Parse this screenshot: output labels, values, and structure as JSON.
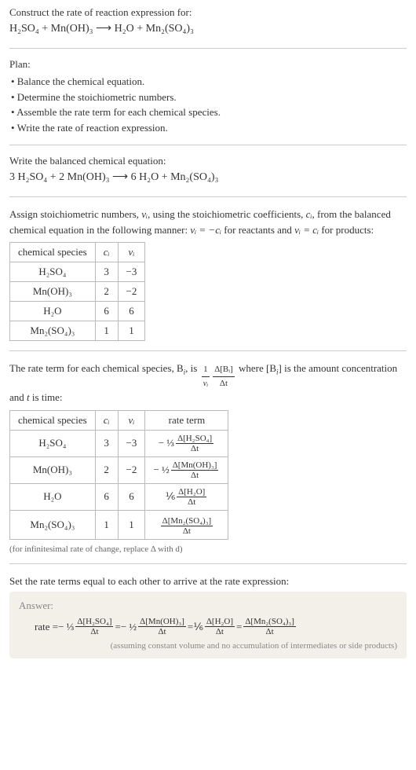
{
  "header": {
    "title": "Construct the rate of reaction expression for:",
    "equation_lhs": "H₂SO₄ + Mn(OH)₃",
    "arrow": "⟶",
    "equation_rhs": "H₂O + Mn₂(SO₄)₃"
  },
  "plan": {
    "label": "Plan:",
    "items": [
      "• Balance the chemical equation.",
      "• Determine the stoichiometric numbers.",
      "• Assemble the rate term for each chemical species.",
      "• Write the rate of reaction expression."
    ]
  },
  "balanced": {
    "label": "Write the balanced chemical equation:",
    "equation": "3 H₂SO₄ + 2 Mn(OH)₃  ⟶  6 H₂O + Mn₂(SO₄)₃"
  },
  "assign": {
    "text_part1": "Assign stoichiometric numbers, ",
    "nu_i": "νᵢ",
    "text_part2": ", using the stoichiometric coefficients, ",
    "c_i": "cᵢ",
    "text_part3": ", from the balanced chemical equation in the following manner: ",
    "rel1": "νᵢ = −cᵢ",
    "text_part4": " for reactants and ",
    "rel2": "νᵢ = cᵢ",
    "text_part5": " for products:",
    "table": {
      "headers": [
        "chemical species",
        "cᵢ",
        "νᵢ"
      ],
      "rows": [
        [
          "H₂SO₄",
          "3",
          "−3"
        ],
        [
          "Mn(OH)₃",
          "2",
          "−2"
        ],
        [
          "H₂O",
          "6",
          "6"
        ],
        [
          "Mn₂(SO₄)₃",
          "1",
          "1"
        ]
      ]
    }
  },
  "rateterm": {
    "text_a": "The rate term for each chemical species, B",
    "text_b": ", is ",
    "text_c": " where [B",
    "text_d": "] is the amount concentration and ",
    "t": "t",
    "text_e": " is time:",
    "frac_left_num": "1",
    "frac_left_den": "νᵢ",
    "frac_right_num": "Δ[Bᵢ]",
    "frac_right_den": "Δt",
    "table": {
      "headers": [
        "chemical species",
        "cᵢ",
        "νᵢ",
        "rate term"
      ],
      "rows": [
        {
          "species": "H₂SO₄",
          "c": "3",
          "nu": "−3",
          "coef": "− ⅓",
          "num": "Δ[H₂SO₄]",
          "den": "Δt"
        },
        {
          "species": "Mn(OH)₃",
          "c": "2",
          "nu": "−2",
          "coef": "− ½",
          "num": "Δ[Mn(OH)₃]",
          "den": "Δt"
        },
        {
          "species": "H₂O",
          "c": "6",
          "nu": "6",
          "coef": "⅙",
          "num": "Δ[H₂O]",
          "den": "Δt"
        },
        {
          "species": "Mn₂(SO₄)₃",
          "c": "1",
          "nu": "1",
          "coef": "",
          "num": "Δ[Mn₂(SO₄)₃]",
          "den": "Δt"
        }
      ]
    },
    "footnote": "(for infinitesimal rate of change, replace Δ with d)"
  },
  "final": {
    "text": "Set the rate terms equal to each other to arrive at the rate expression:",
    "answer_label": "Answer:",
    "rate_label": "rate = ",
    "terms": [
      {
        "coef": "− ⅓",
        "num": "Δ[H₂SO₄]",
        "den": "Δt"
      },
      {
        "coef": "− ½",
        "num": "Δ[Mn(OH)₃]",
        "den": "Δt"
      },
      {
        "coef": "⅙",
        "num": "Δ[H₂O]",
        "den": "Δt"
      },
      {
        "coef": "",
        "num": "Δ[Mn₂(SO₄)₃]",
        "den": "Δt"
      }
    ],
    "eq": " = ",
    "note": "(assuming constant volume and no accumulation of intermediates or side products)"
  }
}
